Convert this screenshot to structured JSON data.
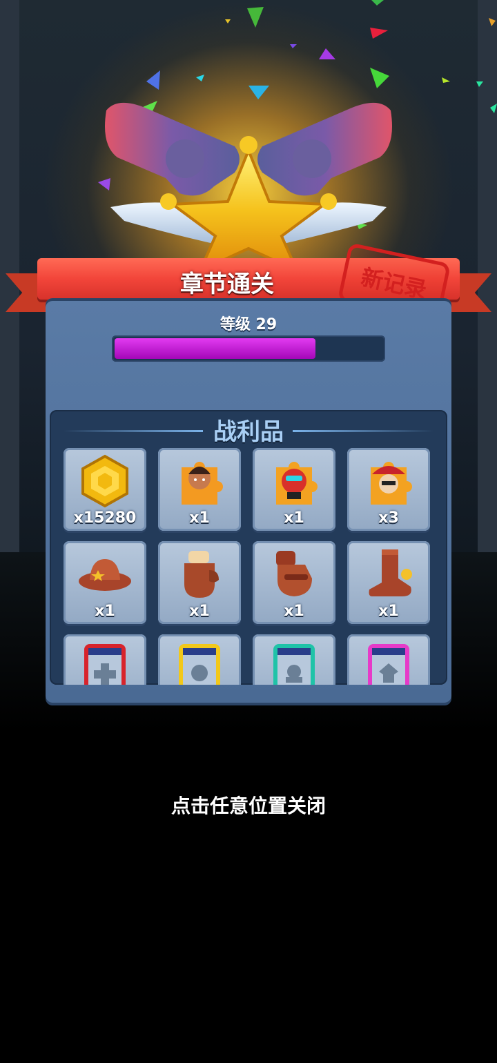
{
  "banner": {
    "title": "章节通关",
    "stamp": "新记录"
  },
  "level": {
    "label": "等级 29",
    "progress": 0.75
  },
  "loot": {
    "title": "战利品",
    "items": [
      {
        "icon": "gold-hex-coin-icon",
        "qty": "x15280"
      },
      {
        "icon": "hero-girl-puzzle-icon",
        "qty": "x1"
      },
      {
        "icon": "robot-hero-puzzle-icon",
        "qty": "x1"
      },
      {
        "icon": "hat-hero-puzzle-icon",
        "qty": "x3"
      },
      {
        "icon": "cowboy-hat-icon",
        "qty": "x1"
      },
      {
        "icon": "leather-glove-icon",
        "qty": "x1"
      },
      {
        "icon": "brown-gauntlet-icon",
        "qty": "x1"
      },
      {
        "icon": "cowboy-boot-icon",
        "qty": "x1"
      },
      {
        "icon": "red-scroll-card-icon",
        "qty": ""
      },
      {
        "icon": "yellow-scroll-card-icon",
        "qty": ""
      },
      {
        "icon": "teal-scroll-card-icon",
        "qty": ""
      },
      {
        "icon": "pink-scroll-card-icon",
        "qty": ""
      }
    ]
  },
  "footer": {
    "close_hint": "点击任意位置关闭"
  },
  "colors": {
    "xp_fill": "#c21ad6",
    "banner_red": "#f2453a",
    "panel_blue": "#4f6f99"
  }
}
